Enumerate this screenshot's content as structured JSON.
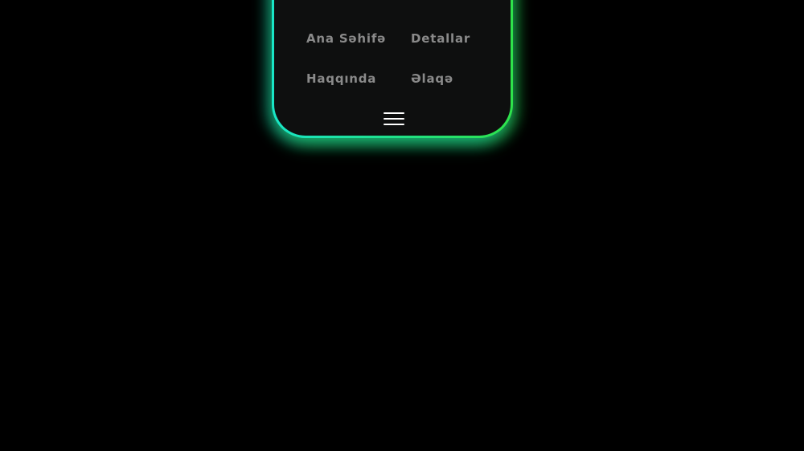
{
  "nav": {
    "items": [
      {
        "label": "Ana Səhifə"
      },
      {
        "label": "Detallar"
      },
      {
        "label": "Haqqında"
      },
      {
        "label": "Əlaqə"
      }
    ]
  },
  "menu_toggle": {
    "icon": "hamburger-menu-icon"
  },
  "colors": {
    "background": "#000000",
    "card": "#0e0f0f",
    "glow_left": "#19e6c7",
    "glow_right": "#2ee34a",
    "link_text": "#8a8a8a",
    "icon": "#ffffff"
  }
}
